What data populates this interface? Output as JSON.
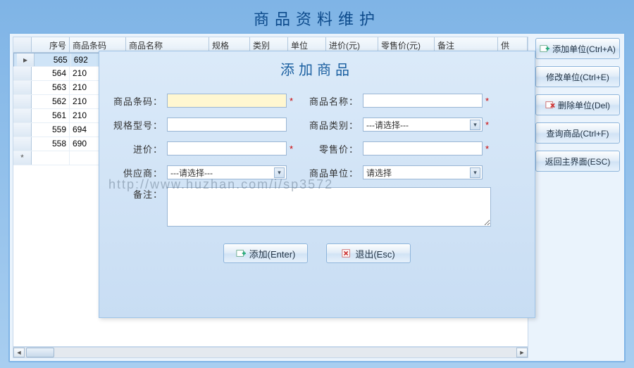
{
  "page_title": "商品资料维护",
  "grid": {
    "headers": [
      "序号",
      "商品条码",
      "商品名称",
      "规格",
      "类别",
      "单位",
      "进价(元)",
      "零售价(元)",
      "备注",
      "供"
    ],
    "rows": [
      {
        "sel": true,
        "seq": "565",
        "bar": "692"
      },
      {
        "seq": "564",
        "bar": "210"
      },
      {
        "seq": "563",
        "bar": "210"
      },
      {
        "seq": "562",
        "bar": "210"
      },
      {
        "seq": "561",
        "bar": "210"
      },
      {
        "seq": "559",
        "bar": "694"
      },
      {
        "seq": "558",
        "bar": "690"
      }
    ],
    "newrow_marker": "*"
  },
  "side": {
    "add": "添加单位(Ctrl+A)",
    "edit": "修改单位(Ctrl+E)",
    "del": "删除单位(Del)",
    "find": "查询商品(Ctrl+F)",
    "back": "返回主界面(ESC)"
  },
  "dialog": {
    "title": "添加商品",
    "labels": {
      "barcode": "商品条码：",
      "name": "商品名称：",
      "spec": "规格型号：",
      "cat": "商品类别：",
      "in": "进价：",
      "out": "零售价：",
      "supplier": "供应商：",
      "unit": "商品单位：",
      "memo": "备注："
    },
    "select_placeholder": "---请选择---",
    "unit_placeholder": "请选择",
    "star": "*",
    "btn_add": "添加(Enter)",
    "btn_exit": "退出(Esc)"
  },
  "watermark": "http://www.huzhan.com/i/sp3572"
}
